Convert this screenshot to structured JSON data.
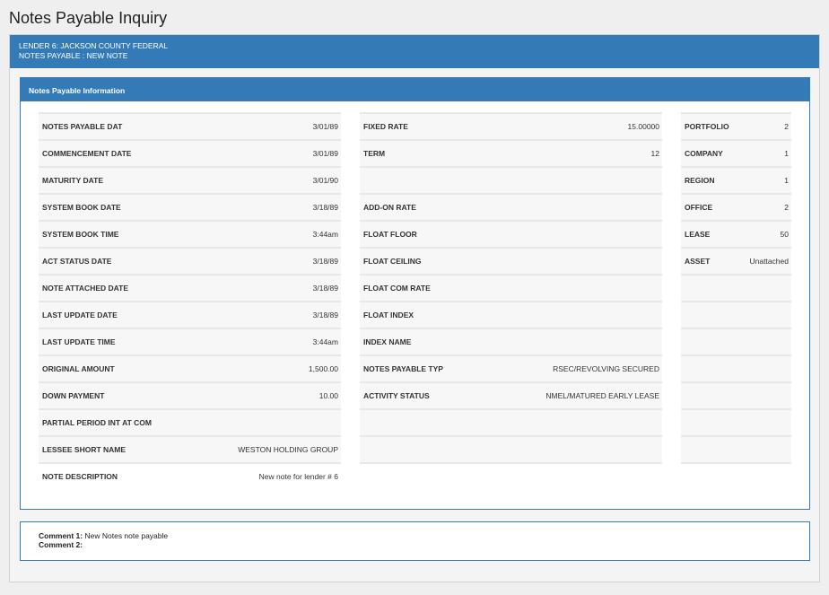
{
  "page": {
    "title": "Notes Payable Inquiry"
  },
  "header": {
    "lender_line": "LENDER 6: JACKSON COUNTY FEDERAL",
    "notes_line": "NOTES PAYABLE : NEW NOTE"
  },
  "panel": {
    "heading": "Notes Payable Information"
  },
  "col1": [
    {
      "label": "NOTES PAYABLE DAT",
      "value": "3/01/89"
    },
    {
      "label": "COMMENCEMENT DATE",
      "value": "3/01/89"
    },
    {
      "label": "MATURITY DATE",
      "value": "3/01/90"
    },
    {
      "label": "SYSTEM BOOK DATE",
      "value": "3/18/89"
    },
    {
      "label": "SYSTEM BOOK TIME",
      "value": "3:44am"
    },
    {
      "label": "ACT STATUS DATE",
      "value": "3/18/89"
    },
    {
      "label": "NOTE ATTACHED DATE",
      "value": "3/18/89"
    },
    {
      "label": "LAST UPDATE DATE",
      "value": "3/18/89"
    },
    {
      "label": "LAST UPDATE TIME",
      "value": "3:44am"
    },
    {
      "label": "ORIGINAL AMOUNT",
      "value": "1,500.00"
    },
    {
      "label": "DOWN PAYMENT",
      "value": "10.00"
    },
    {
      "label": "PARTIAL PERIOD INT AT COM",
      "value": ""
    },
    {
      "label": "LESSEE SHORT NAME",
      "value": "WESTON HOLDING GROUP"
    },
    {
      "label": "NOTE DESCRIPTION",
      "value": "New note for lender # 6"
    }
  ],
  "col2": [
    {
      "label": "FIXED RATE",
      "value": "15.00000"
    },
    {
      "label": "TERM",
      "value": "12"
    },
    {
      "label": "",
      "value": ""
    },
    {
      "label": "ADD-ON RATE",
      "value": ""
    },
    {
      "label": "FLOAT FLOOR",
      "value": ""
    },
    {
      "label": "FLOAT CEILING",
      "value": ""
    },
    {
      "label": "FLOAT COM RATE",
      "value": ""
    },
    {
      "label": "FLOAT INDEX",
      "value": ""
    },
    {
      "label": "INDEX NAME",
      "value": ""
    },
    {
      "label": "NOTES PAYABLE TYP",
      "value": "RSEC/REVOLVING SECURED"
    },
    {
      "label": "ACTIVITY STATUS",
      "value": "NMEL/MATURED EARLY LEASE"
    },
    {
      "label": "",
      "value": ""
    },
    {
      "label": "",
      "value": ""
    },
    {
      "label": "",
      "value": ""
    }
  ],
  "col3": [
    {
      "label": "PORTFOLIO",
      "value": "2"
    },
    {
      "label": "COMPANY",
      "value": "1"
    },
    {
      "label": "REGION",
      "value": "1"
    },
    {
      "label": "OFFICE",
      "value": "2"
    },
    {
      "label": "LEASE",
      "value": "50"
    },
    {
      "label": "ASSET",
      "value": "Unattached"
    },
    {
      "label": "",
      "value": ""
    },
    {
      "label": "",
      "value": ""
    },
    {
      "label": "",
      "value": ""
    },
    {
      "label": "",
      "value": ""
    },
    {
      "label": "",
      "value": ""
    },
    {
      "label": "",
      "value": ""
    },
    {
      "label": "",
      "value": ""
    },
    {
      "label": "",
      "value": ""
    }
  ],
  "comments": [
    {
      "label": "Comment 1:",
      "text": "New Notes note payable"
    },
    {
      "label": "Comment 2:",
      "text": ""
    }
  ]
}
